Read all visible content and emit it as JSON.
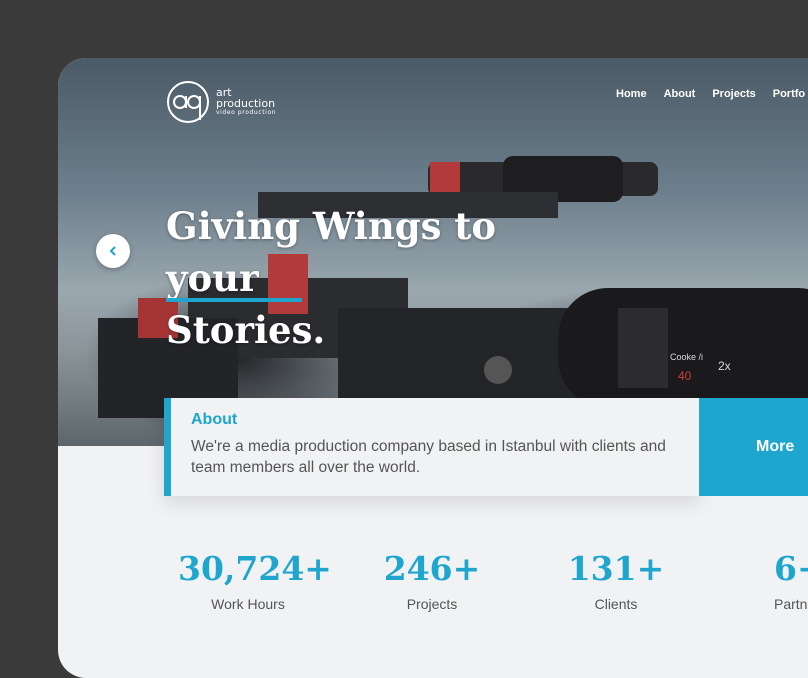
{
  "brand": {
    "mark": "ap",
    "line1": "art",
    "line2": "production",
    "line3": "video production"
  },
  "nav": [
    "Home",
    "About",
    "Projects",
    "Portfo"
  ],
  "hero": {
    "line1": "Giving Wings to your",
    "line2": "Stories."
  },
  "about": {
    "title": "About",
    "body": "We're a media production company based in Istanbul with clients and team members all over the world.",
    "more_label": "More"
  },
  "stats": [
    {
      "value": "30,724+",
      "label": "Work Hours"
    },
    {
      "value": "246+",
      "label": "Projects"
    },
    {
      "value": "131+",
      "label": "Clients"
    },
    {
      "value": "6+",
      "label": "Partn"
    }
  ],
  "colors": {
    "accent": "#1ea6cf",
    "background": "#3a3a3a",
    "card": "#f1f2f4"
  }
}
